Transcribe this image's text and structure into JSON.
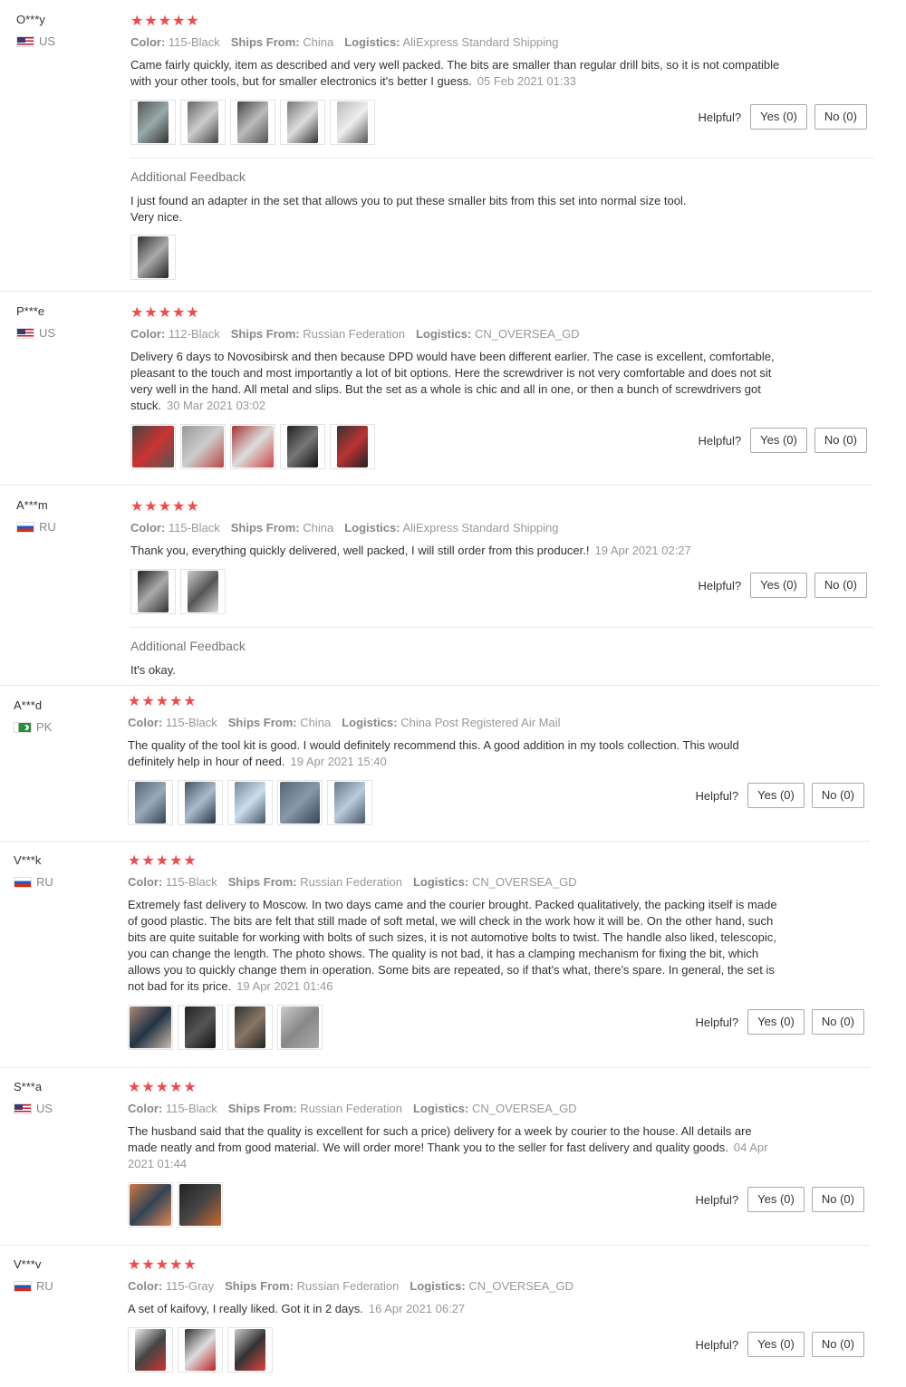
{
  "helpful_label": "Helpful?",
  "yes_label": "Yes (0)",
  "no_label": "No (0)",
  "color_label": "Color:",
  "ships_label": "Ships From:",
  "logistics_label": "Logistics:",
  "additional_label": "Additional Feedback",
  "stars": "★★★★★",
  "reviews": [
    {
      "user": "O***y",
      "country": "US",
      "color": "115-Black",
      "ships": "China",
      "logistics": "AliExpress Standard Shipping",
      "text": "Came fairly quickly, item as described and very well packed. The bits are smaller than regular drill bits, so it is not compatible with your other tools, but for smaller electronics it's better I guess.",
      "date": "05 Feb 2021 01:33",
      "additional": "I just found an adapter in the set that allows you to put these smaller bits from this set into normal size tool.\nVery nice."
    },
    {
      "user": "P***e",
      "country": "US",
      "color": "112-Black",
      "ships": "Russian Federation",
      "logistics": "CN_OVERSEA_GD",
      "text": "Delivery 6 days to Novosibirsk and then because DPD would have been different earlier. The case is excellent, comfortable, pleasant to the touch and most importantly a lot of bit options. Here the screwdriver is not very comfortable and does not sit very well in the hand. All metal and slips. But the set as a whole is chic and all in one, or then a bunch of screwdrivers got stuck.",
      "date": "30 Mar 2021 03:02"
    },
    {
      "user": "A***m",
      "country": "RU",
      "color": "115-Black",
      "ships": "China",
      "logistics": "AliExpress Standard Shipping",
      "text": "Thank you, everything quickly delivered, well packed, I will still order from this producer.!",
      "date": "19 Apr 2021 02:27",
      "additional": "It's okay."
    },
    {
      "user": "A***d",
      "country": "PK",
      "color": "115-Black",
      "ships": "China",
      "logistics": "China Post Registered Air Mail",
      "text": "The quality of the tool kit is good. I would definitely recommend this. A good addition in my tools collection. This would definitely help in hour of need.",
      "date": "19 Apr 2021 15:40"
    },
    {
      "user": "V***k",
      "country": "RU",
      "color": "115-Black",
      "ships": "Russian Federation",
      "logistics": "CN_OVERSEA_GD",
      "text": "Extremely fast delivery to Moscow. In two days came and the courier brought. Packed qualitatively, the packing itself is made of good plastic. The bits are felt that still made of soft metal, we will check in the work how it will be. On the other hand, such bits are quite suitable for working with bolts of such sizes, it is not automotive bolts to twist. The handle also liked, telescopic, you can change the length. The photo shows. The quality is not bad, it has a clamping mechanism for fixing the bit, which allows you to quickly change them in operation. Some bits are repeated, so if that's what, there's spare. In general, the set is not bad for its price.",
      "date": "19 Apr 2021 01:46"
    },
    {
      "user": "S***a",
      "country": "US",
      "color": "115-Black",
      "ships": "Russian Federation",
      "logistics": "CN_OVERSEA_GD",
      "text": "The husband said that the quality is excellent for such a price) delivery for a week by courier to the house. All details are made neatly and from good material. We will order more! Thank you to the seller for fast delivery and quality goods.",
      "date": "04 Apr 2021 01:44"
    },
    {
      "user": "V***v",
      "country": "RU",
      "color": "115-Gray",
      "ships": "Russian Federation",
      "logistics": "CN_OVERSEA_GD",
      "text": "A set of kaifovy, I really liked. Got it in 2 days.",
      "date": "16 Apr 2021 06:27"
    }
  ]
}
